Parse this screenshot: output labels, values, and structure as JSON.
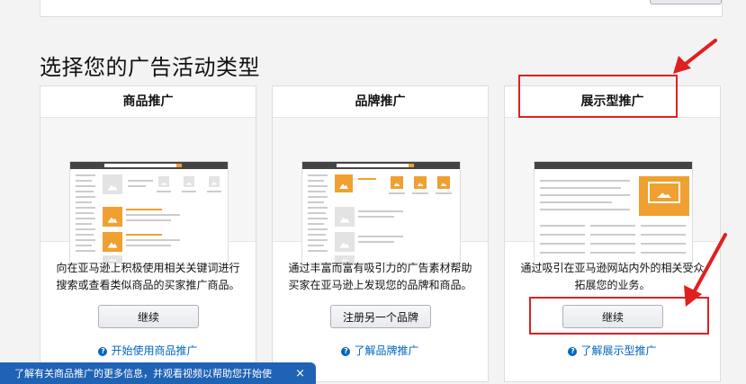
{
  "section_title": "选择您的广告活动类型",
  "cards": [
    {
      "header": "商品推广",
      "description": "向在亚马逊上积极使用相关关键词进行搜索或查看类似商品的买家推广商品。",
      "button": "继续",
      "link": "开始使用商品推广"
    },
    {
      "header": "品牌推广",
      "description": "通过丰富而富有吸引力的广告素材帮助买家在亚马逊上发现您的品牌和商品。",
      "button": "注册另一个品牌",
      "link": "了解品牌推广"
    },
    {
      "header": "展示型推广",
      "description": "通过吸引在亚马逊网站内外的相关受众拓展您的业务。",
      "button": "继续",
      "link": "了解展示型推广"
    }
  ],
  "mock_logo": "amazon",
  "help_icon": "?",
  "toast": {
    "text": "了解有关商品推广的更多信息，并观看视频以帮助您开始使",
    "close": "×"
  },
  "colors": {
    "accent": "#f0a030",
    "link": "#0066c0",
    "annotation": "#e02020",
    "toast": "#1f63b5"
  },
  "icons": [
    "help-circle-icon",
    "close-icon",
    "arrow-icon"
  ]
}
